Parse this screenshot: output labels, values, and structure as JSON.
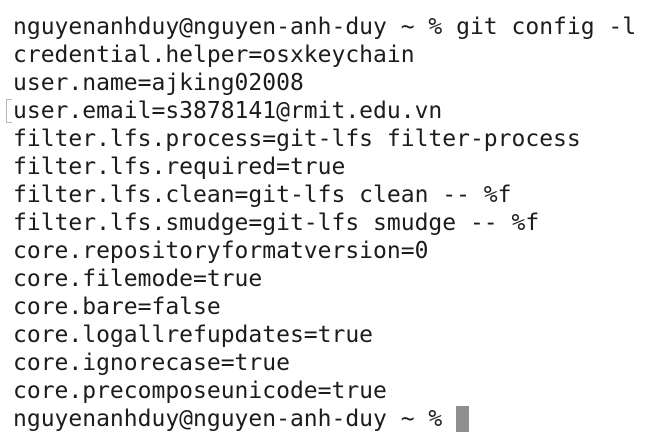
{
  "command_prompt": "nguyenanhduy@nguyen-anh-duy ~ % git config -l",
  "output_lines": [
    "credential.helper=osxkeychain",
    "user.name=ajking02008",
    "user.email=s3878141@rmit.edu.vn",
    "filter.lfs.process=git-lfs filter-process",
    "filter.lfs.required=true",
    "filter.lfs.clean=git-lfs clean -- %f",
    "filter.lfs.smudge=git-lfs smudge -- %f",
    "core.repositoryformatversion=0",
    "core.filemode=true",
    "core.bare=false",
    "core.logallrefupdates=true",
    "core.ignorecase=true",
    "core.precomposeunicode=true"
  ],
  "final_prompt": "nguyenanhduy@nguyen-anh-duy ~ %",
  "colors": {
    "background": "#ffffff",
    "text": "#1c1c1c",
    "cursor": "#8f8f8f"
  }
}
